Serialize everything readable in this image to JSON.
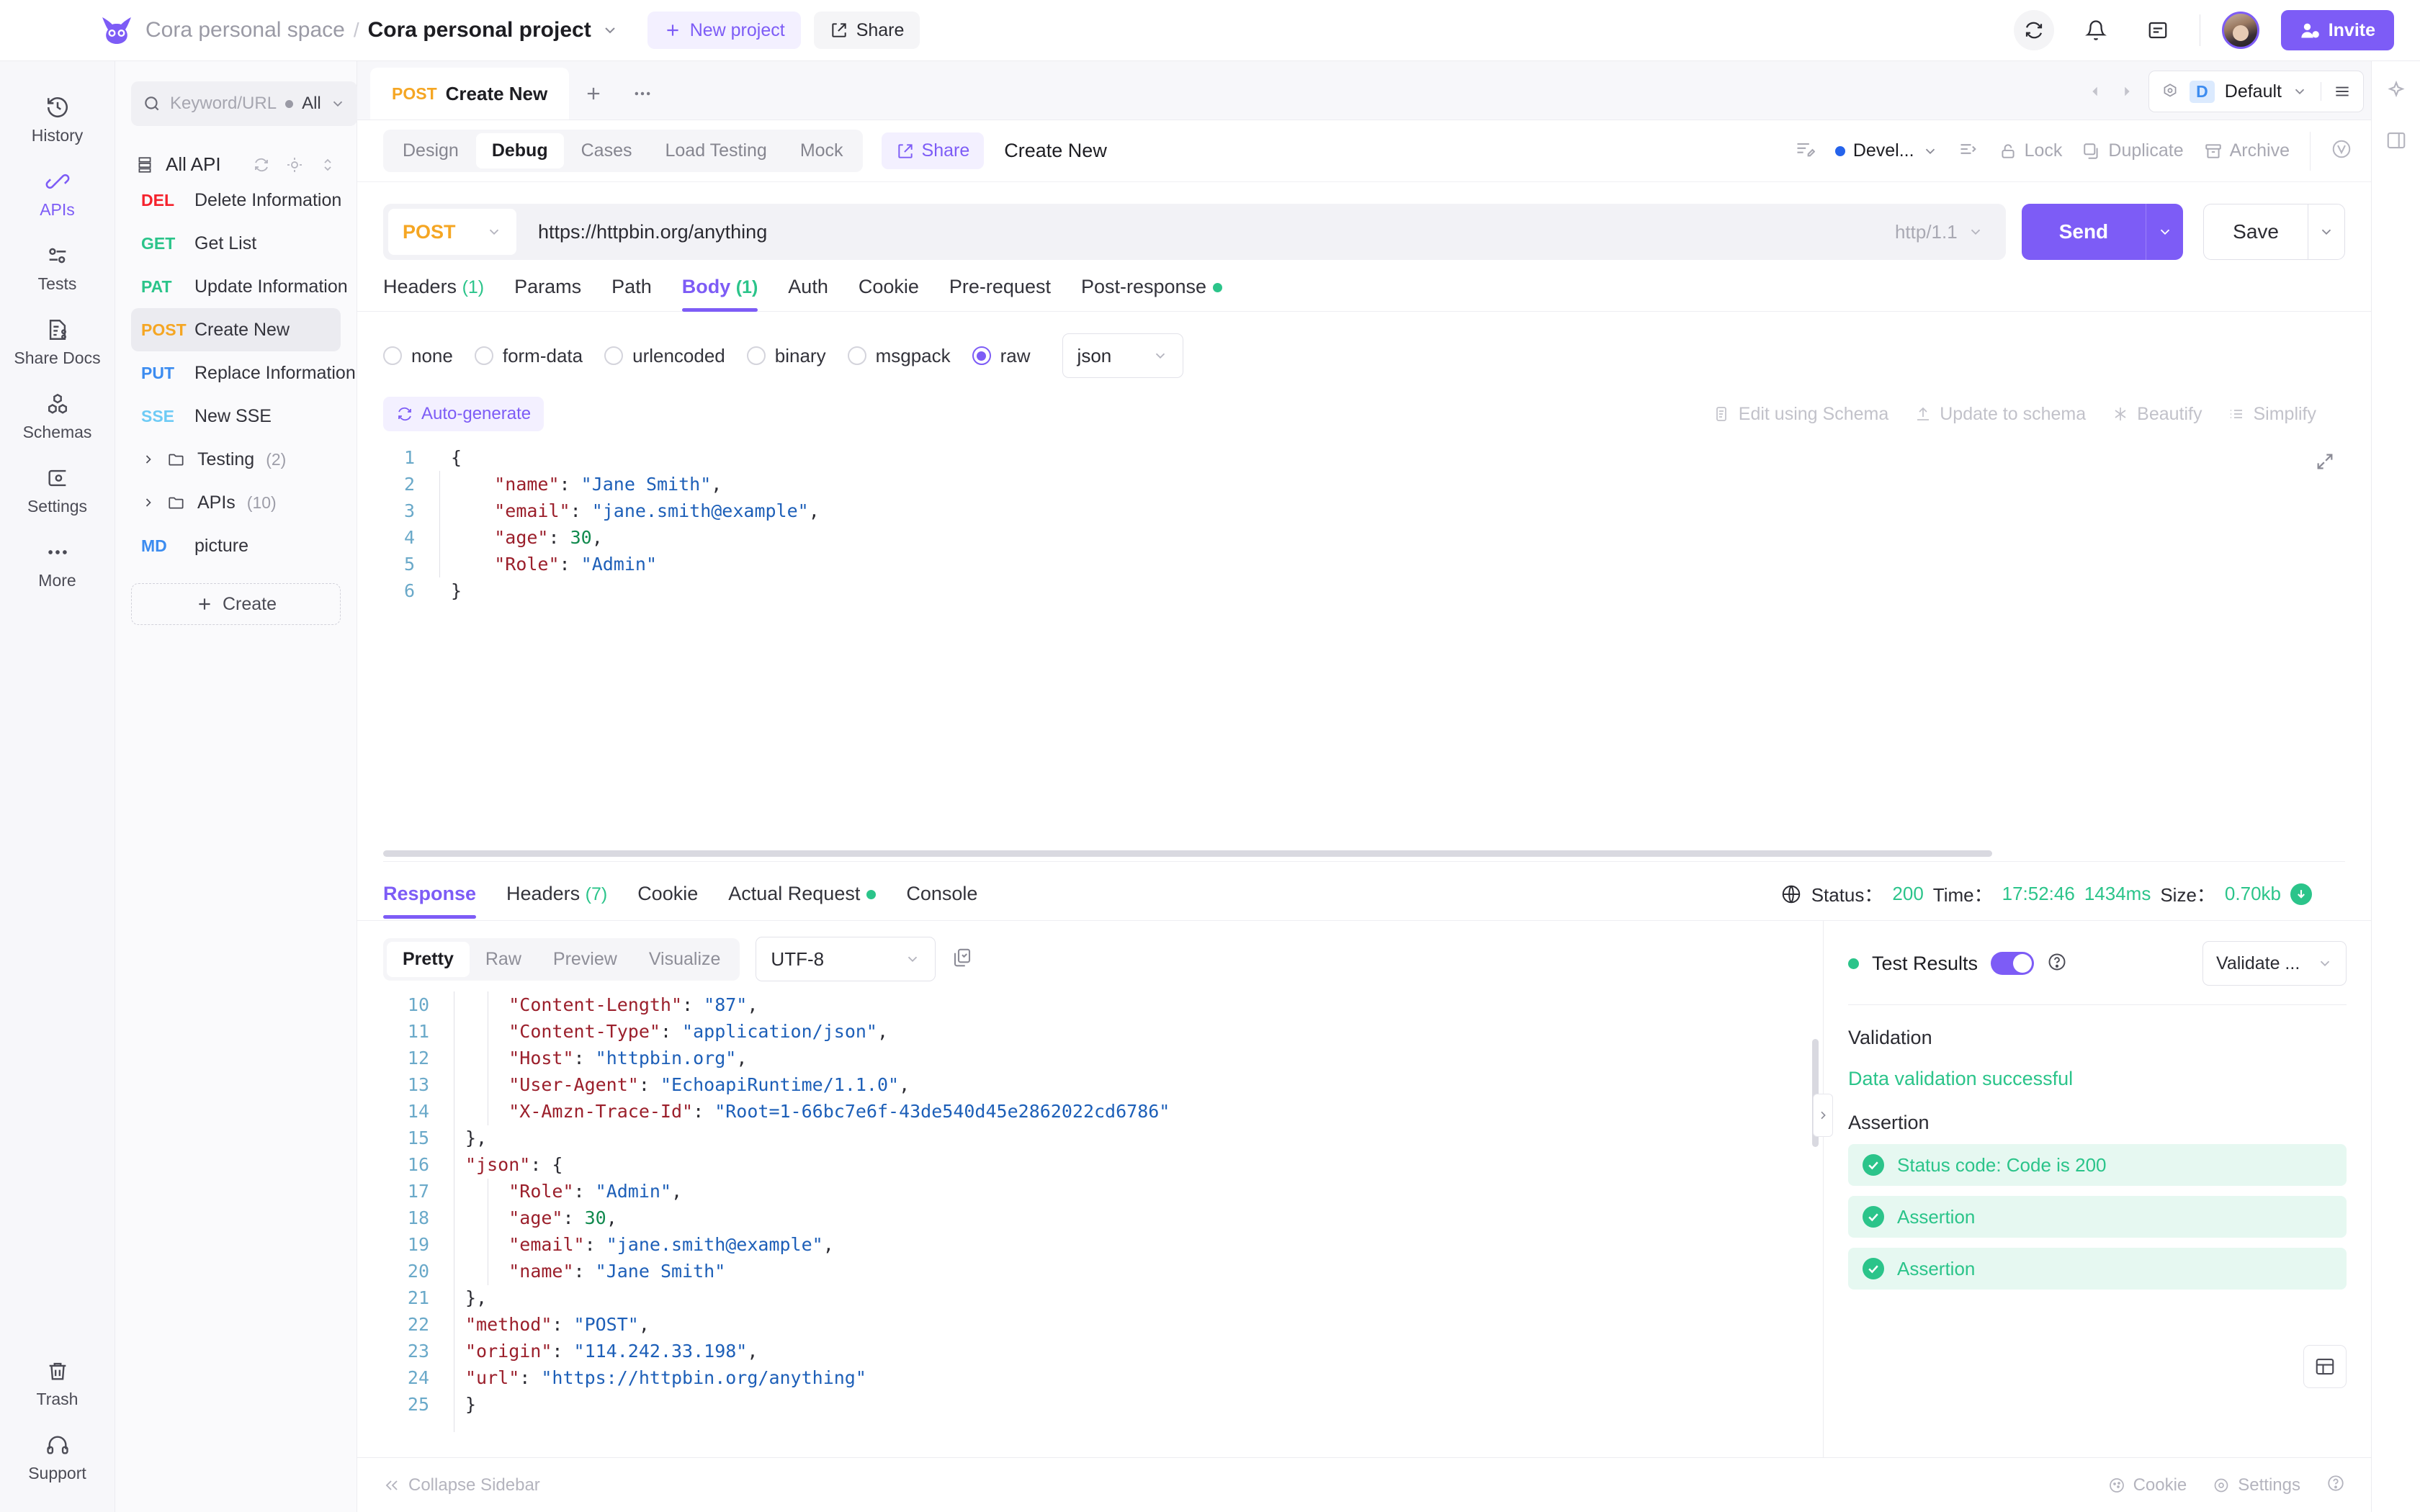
{
  "topbar": {
    "space": "Cora personal space",
    "separator": "/",
    "project": "Cora personal project",
    "new_project": "New project",
    "share": "Share",
    "invite": "Invite"
  },
  "rail": {
    "items": [
      {
        "label": "History",
        "icon": "history-icon",
        "active": false
      },
      {
        "label": "APIs",
        "icon": "apis-icon",
        "active": true
      },
      {
        "label": "Tests",
        "icon": "tests-icon",
        "active": false
      },
      {
        "label": "Share Docs",
        "icon": "share-docs-icon",
        "active": false
      },
      {
        "label": "Schemas",
        "icon": "schemas-icon",
        "active": false
      },
      {
        "label": "Settings",
        "icon": "settings-icon",
        "active": false
      },
      {
        "label": "More",
        "icon": "more-icon",
        "active": false
      }
    ],
    "bottom": [
      {
        "label": "Trash",
        "icon": "trash-icon"
      },
      {
        "label": "Support",
        "icon": "support-icon"
      }
    ]
  },
  "sidebar": {
    "search_placeholder": "Keyword/URL",
    "filter_label": "All",
    "tree_title": "All API",
    "create_label": "Create",
    "items": [
      {
        "method": "DEL",
        "name": "Delete Information",
        "selected": false
      },
      {
        "method": "GET",
        "name": "Get List",
        "selected": false
      },
      {
        "method": "PAT",
        "name": "Update Information",
        "selected": false
      },
      {
        "method": "POST",
        "name": "Create New",
        "selected": true
      },
      {
        "method": "PUT",
        "name": "Replace Information",
        "selected": false
      },
      {
        "method": "SSE",
        "name": "New SSE",
        "selected": false
      }
    ],
    "folders": [
      {
        "name": "Testing",
        "count": "(2)"
      },
      {
        "name": "APIs",
        "count": "(10)"
      }
    ],
    "docs": [
      {
        "method": "MD",
        "name": "picture"
      }
    ]
  },
  "tabstrip": {
    "doc_method": "POST",
    "doc_name": "Create New",
    "env_badge": "D",
    "env_name": "Default"
  },
  "actionrow": {
    "modes": [
      {
        "label": "Design",
        "active": false
      },
      {
        "label": "Debug",
        "active": true
      },
      {
        "label": "Cases",
        "active": false
      },
      {
        "label": "Load Testing",
        "active": false
      },
      {
        "label": "Mock",
        "active": false
      }
    ],
    "share_label": "Share",
    "request_title": "Create New",
    "status_label": "Devel...",
    "lock": "Lock",
    "duplicate": "Duplicate",
    "archive": "Archive"
  },
  "urlbar": {
    "method": "POST",
    "url": "https://httpbin.org/anything",
    "http_version": "http/1.1",
    "send": "Send",
    "save": "Save"
  },
  "request_tabs": [
    {
      "label": "Headers",
      "count": "(1)",
      "active": false,
      "dot": false
    },
    {
      "label": "Params",
      "count": "",
      "active": false,
      "dot": false
    },
    {
      "label": "Path",
      "count": "",
      "active": false,
      "dot": false
    },
    {
      "label": "Body",
      "count": "(1)",
      "active": true,
      "dot": false
    },
    {
      "label": "Auth",
      "count": "",
      "active": false,
      "dot": false
    },
    {
      "label": "Cookie",
      "count": "",
      "active": false,
      "dot": false
    },
    {
      "label": "Pre-request",
      "count": "",
      "active": false,
      "dot": false
    },
    {
      "label": "Post-response",
      "count": "",
      "active": false,
      "dot": true
    }
  ],
  "body_types": [
    {
      "label": "none",
      "selected": false
    },
    {
      "label": "form-data",
      "selected": false
    },
    {
      "label": "urlencoded",
      "selected": false
    },
    {
      "label": "binary",
      "selected": false
    },
    {
      "label": "msgpack",
      "selected": false
    },
    {
      "label": "raw",
      "selected": true
    }
  ],
  "body_format": "json",
  "editor_toolbar": {
    "auto_generate": "Auto-generate",
    "edit_using_schema": "Edit using Schema",
    "update_to_schema": "Update to schema",
    "beautify": "Beautify",
    "simplify": "Simplify"
  },
  "request_body": {
    "lines": [
      {
        "no": "1",
        "tokens": [
          {
            "t": "{",
            "c": "p"
          }
        ]
      },
      {
        "no": "2",
        "tokens": [
          {
            "t": "    ",
            "c": "p"
          },
          {
            "t": "\"name\"",
            "c": "k"
          },
          {
            "t": ": ",
            "c": "p"
          },
          {
            "t": "\"Jane Smith\"",
            "c": "s"
          },
          {
            "t": ",",
            "c": "p"
          }
        ]
      },
      {
        "no": "3",
        "tokens": [
          {
            "t": "    ",
            "c": "p"
          },
          {
            "t": "\"email\"",
            "c": "k"
          },
          {
            "t": ": ",
            "c": "p"
          },
          {
            "t": "\"jane.smith@example\"",
            "c": "s"
          },
          {
            "t": ",",
            "c": "p"
          }
        ]
      },
      {
        "no": "4",
        "tokens": [
          {
            "t": "    ",
            "c": "p"
          },
          {
            "t": "\"age\"",
            "c": "k"
          },
          {
            "t": ": ",
            "c": "p"
          },
          {
            "t": "30",
            "c": "n"
          },
          {
            "t": ",",
            "c": "p"
          }
        ]
      },
      {
        "no": "5",
        "tokens": [
          {
            "t": "    ",
            "c": "p"
          },
          {
            "t": "\"Role\"",
            "c": "k"
          },
          {
            "t": ": ",
            "c": "p"
          },
          {
            "t": "\"Admin\"",
            "c": "s"
          }
        ]
      },
      {
        "no": "6",
        "tokens": [
          {
            "t": "}",
            "c": "p"
          }
        ]
      }
    ]
  },
  "response_tabs": [
    {
      "label": "Response",
      "count": "",
      "active": true,
      "dot": false
    },
    {
      "label": "Headers",
      "count": "(7)",
      "active": false,
      "dot": false
    },
    {
      "label": "Cookie",
      "count": "",
      "active": false,
      "dot": false
    },
    {
      "label": "Actual Request",
      "count": "",
      "active": false,
      "dot": true
    },
    {
      "label": "Console",
      "count": "",
      "active": false,
      "dot": false
    }
  ],
  "response_status": {
    "status_label": "Status：",
    "status_value": "200",
    "time_label": "Time：",
    "time_value": "17:52:46",
    "duration": "1434ms",
    "size_label": "Size：",
    "size_value": "0.70kb"
  },
  "response_format": {
    "tabs": [
      {
        "label": "Pretty",
        "active": true
      },
      {
        "label": "Raw",
        "active": false
      },
      {
        "label": "Preview",
        "active": false
      },
      {
        "label": "Visualize",
        "active": false
      }
    ],
    "encoding": "UTF-8"
  },
  "response_body": {
    "lines": [
      {
        "no": "10",
        "indent": 2,
        "tokens": [
          {
            "t": "    ",
            "c": "p"
          },
          {
            "t": "\"Content-Length\"",
            "c": "k"
          },
          {
            "t": ": ",
            "c": "p"
          },
          {
            "t": "\"87\"",
            "c": "s"
          },
          {
            "t": ",",
            "c": "p"
          }
        ]
      },
      {
        "no": "11",
        "indent": 2,
        "tokens": [
          {
            "t": "    ",
            "c": "p"
          },
          {
            "t": "\"Content-Type\"",
            "c": "k"
          },
          {
            "t": ": ",
            "c": "p"
          },
          {
            "t": "\"application/json\"",
            "c": "s"
          },
          {
            "t": ",",
            "c": "p"
          }
        ]
      },
      {
        "no": "12",
        "indent": 2,
        "tokens": [
          {
            "t": "    ",
            "c": "p"
          },
          {
            "t": "\"Host\"",
            "c": "k"
          },
          {
            "t": ": ",
            "c": "p"
          },
          {
            "t": "\"httpbin.org\"",
            "c": "s"
          },
          {
            "t": ",",
            "c": "p"
          }
        ]
      },
      {
        "no": "13",
        "indent": 2,
        "tokens": [
          {
            "t": "    ",
            "c": "p"
          },
          {
            "t": "\"User-Agent\"",
            "c": "k"
          },
          {
            "t": ": ",
            "c": "p"
          },
          {
            "t": "\"EchoapiRuntime/1.1.0\"",
            "c": "s"
          },
          {
            "t": ",",
            "c": "p"
          }
        ]
      },
      {
        "no": "14",
        "indent": 2,
        "tokens": [
          {
            "t": "    ",
            "c": "p"
          },
          {
            "t": "\"X-Amzn-Trace-Id\"",
            "c": "k"
          },
          {
            "t": ": ",
            "c": "p"
          },
          {
            "t": "\"Root=1-66bc7e6f-43de540d45e2862022cd6786\"",
            "c": "s"
          }
        ]
      },
      {
        "no": "15",
        "indent": 1,
        "tokens": [
          {
            "t": "},",
            "c": "p"
          }
        ]
      },
      {
        "no": "16",
        "indent": 1,
        "tokens": [
          {
            "t": "\"json\"",
            "c": "k"
          },
          {
            "t": ": {",
            "c": "p"
          }
        ]
      },
      {
        "no": "17",
        "indent": 2,
        "tokens": [
          {
            "t": "    ",
            "c": "p"
          },
          {
            "t": "\"Role\"",
            "c": "k"
          },
          {
            "t": ": ",
            "c": "p"
          },
          {
            "t": "\"Admin\"",
            "c": "s"
          },
          {
            "t": ",",
            "c": "p"
          }
        ]
      },
      {
        "no": "18",
        "indent": 2,
        "tokens": [
          {
            "t": "    ",
            "c": "p"
          },
          {
            "t": "\"age\"",
            "c": "k"
          },
          {
            "t": ": ",
            "c": "p"
          },
          {
            "t": "30",
            "c": "n"
          },
          {
            "t": ",",
            "c": "p"
          }
        ]
      },
      {
        "no": "19",
        "indent": 2,
        "tokens": [
          {
            "t": "    ",
            "c": "p"
          },
          {
            "t": "\"email\"",
            "c": "k"
          },
          {
            "t": ": ",
            "c": "p"
          },
          {
            "t": "\"jane.smith@example\"",
            "c": "s"
          },
          {
            "t": ",",
            "c": "p"
          }
        ]
      },
      {
        "no": "20",
        "indent": 2,
        "tokens": [
          {
            "t": "    ",
            "c": "p"
          },
          {
            "t": "\"name\"",
            "c": "k"
          },
          {
            "t": ": ",
            "c": "p"
          },
          {
            "t": "\"Jane Smith\"",
            "c": "s"
          }
        ]
      },
      {
        "no": "21",
        "indent": 1,
        "tokens": [
          {
            "t": "},",
            "c": "p"
          }
        ]
      },
      {
        "no": "22",
        "indent": 1,
        "tokens": [
          {
            "t": "\"method\"",
            "c": "k"
          },
          {
            "t": ": ",
            "c": "p"
          },
          {
            "t": "\"POST\"",
            "c": "s"
          },
          {
            "t": ",",
            "c": "p"
          }
        ]
      },
      {
        "no": "23",
        "indent": 1,
        "tokens": [
          {
            "t": "\"origin\"",
            "c": "k"
          },
          {
            "t": ": ",
            "c": "p"
          },
          {
            "t": "\"114.242.33.198\"",
            "c": "s"
          },
          {
            "t": ",",
            "c": "p"
          }
        ]
      },
      {
        "no": "24",
        "indent": 1,
        "tokens": [
          {
            "t": "\"url\"",
            "c": "k"
          },
          {
            "t": ": ",
            "c": "p"
          },
          {
            "t": "\"https://httpbin.org/anything\"",
            "c": "s"
          }
        ]
      },
      {
        "no": "25",
        "indent": 0,
        "tokens": [
          {
            "t": "}",
            "c": "p"
          }
        ]
      }
    ]
  },
  "test_results": {
    "title": "Test Results",
    "dropdown": "Validate ...",
    "validation_heading": "Validation",
    "validation_message": "Data validation successful",
    "assertion_heading": "Assertion",
    "assertions": [
      {
        "label": "Status code: Code is 200",
        "passed": true
      },
      {
        "label": "Assertion",
        "passed": true
      },
      {
        "label": "Assertion",
        "passed": true
      }
    ]
  },
  "bottombar": {
    "collapse": "Collapse Sidebar",
    "cookie": "Cookie",
    "settings": "Settings"
  },
  "colors": {
    "accent": "#7d5cf6",
    "success": "#2bc48a",
    "post": "#f5a623",
    "get": "#2bc48a",
    "del": "#f5222d",
    "put": "#3c8cf0",
    "sse": "#6ecbf5"
  }
}
